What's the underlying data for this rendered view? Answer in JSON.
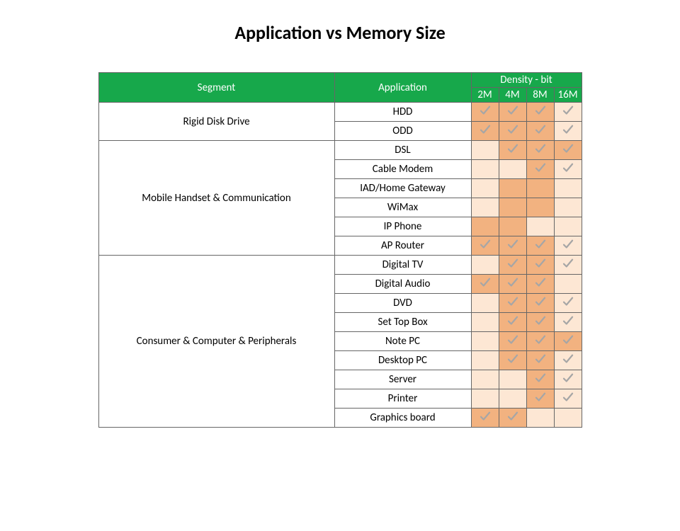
{
  "title": "Application vs Memory Size",
  "headers": {
    "segment": "Segment",
    "application": "Application",
    "density": "Density - bit",
    "cols": [
      "2M",
      "4M",
      "8M",
      "16M"
    ]
  },
  "segments": [
    {
      "name": "Rigid Disk Drive",
      "rows": [
        {
          "app": "HDD",
          "d": [
            {
              "s": "d",
              "c": true
            },
            {
              "s": "d",
              "c": true
            },
            {
              "s": "d",
              "c": true
            },
            {
              "s": "l",
              "c": true
            }
          ]
        },
        {
          "app": "ODD",
          "d": [
            {
              "s": "d",
              "c": true
            },
            {
              "s": "d",
              "c": true
            },
            {
              "s": "d",
              "c": true
            },
            {
              "s": "l",
              "c": true
            }
          ]
        }
      ]
    },
    {
      "name": "Mobile Handset & Communication",
      "rows": [
        {
          "app": "DSL",
          "d": [
            {
              "s": "l",
              "c": false
            },
            {
              "s": "d",
              "c": true
            },
            {
              "s": "d",
              "c": true
            },
            {
              "s": "d",
              "c": true
            }
          ]
        },
        {
          "app": "Cable Modem",
          "d": [
            {
              "s": "l",
              "c": false
            },
            {
              "s": "l",
              "c": false
            },
            {
              "s": "d",
              "c": true
            },
            {
              "s": "l",
              "c": true
            }
          ]
        },
        {
          "app": "IAD/Home Gateway",
          "d": [
            {
              "s": "l",
              "c": false
            },
            {
              "s": "d",
              "c": false
            },
            {
              "s": "d",
              "c": false
            },
            {
              "s": "l",
              "c": false
            }
          ]
        },
        {
          "app": "WiMax",
          "d": [
            {
              "s": "l",
              "c": false
            },
            {
              "s": "d",
              "c": false
            },
            {
              "s": "d",
              "c": false
            },
            {
              "s": "l",
              "c": false
            }
          ]
        },
        {
          "app": "IP Phone",
          "d": [
            {
              "s": "d",
              "c": false
            },
            {
              "s": "d",
              "c": false
            },
            {
              "s": "l",
              "c": false
            },
            {
              "s": "l",
              "c": false
            }
          ]
        },
        {
          "app": "AP Router",
          "d": [
            {
              "s": "d",
              "c": true
            },
            {
              "s": "d",
              "c": true
            },
            {
              "s": "d",
              "c": true
            },
            {
              "s": "l",
              "c": true
            }
          ]
        }
      ]
    },
    {
      "name": "Consumer & Computer & Peripherals",
      "rows": [
        {
          "app": "Digital TV",
          "d": [
            {
              "s": "l",
              "c": false
            },
            {
              "s": "d",
              "c": true
            },
            {
              "s": "d",
              "c": true
            },
            {
              "s": "l",
              "c": true
            }
          ]
        },
        {
          "app": "Digital Audio",
          "d": [
            {
              "s": "d",
              "c": true
            },
            {
              "s": "d",
              "c": true
            },
            {
              "s": "d",
              "c": true
            },
            {
              "s": "l",
              "c": false
            }
          ]
        },
        {
          "app": "DVD",
          "d": [
            {
              "s": "l",
              "c": false
            },
            {
              "s": "d",
              "c": true
            },
            {
              "s": "d",
              "c": true
            },
            {
              "s": "l",
              "c": true
            }
          ]
        },
        {
          "app": "Set Top Box",
          "d": [
            {
              "s": "l",
              "c": false
            },
            {
              "s": "d",
              "c": true
            },
            {
              "s": "d",
              "c": true
            },
            {
              "s": "l",
              "c": true
            }
          ]
        },
        {
          "app": "Note PC",
          "d": [
            {
              "s": "l",
              "c": false
            },
            {
              "s": "d",
              "c": true
            },
            {
              "s": "d",
              "c": true
            },
            {
              "s": "d",
              "c": true
            }
          ]
        },
        {
          "app": "Desktop PC",
          "d": [
            {
              "s": "l",
              "c": false
            },
            {
              "s": "d",
              "c": true
            },
            {
              "s": "d",
              "c": true
            },
            {
              "s": "l",
              "c": true
            }
          ]
        },
        {
          "app": "Server",
          "d": [
            {
              "s": "l",
              "c": false
            },
            {
              "s": "l",
              "c": false
            },
            {
              "s": "d",
              "c": true
            },
            {
              "s": "l",
              "c": true
            }
          ]
        },
        {
          "app": "Printer",
          "d": [
            {
              "s": "l",
              "c": false
            },
            {
              "s": "l",
              "c": false
            },
            {
              "s": "d",
              "c": true
            },
            {
              "s": "l",
              "c": true
            }
          ]
        },
        {
          "app": "Graphics board",
          "d": [
            {
              "s": "d",
              "c": true
            },
            {
              "s": "d",
              "c": true
            },
            {
              "s": "l",
              "c": false
            },
            {
              "s": "l",
              "c": false
            }
          ]
        }
      ]
    }
  ]
}
